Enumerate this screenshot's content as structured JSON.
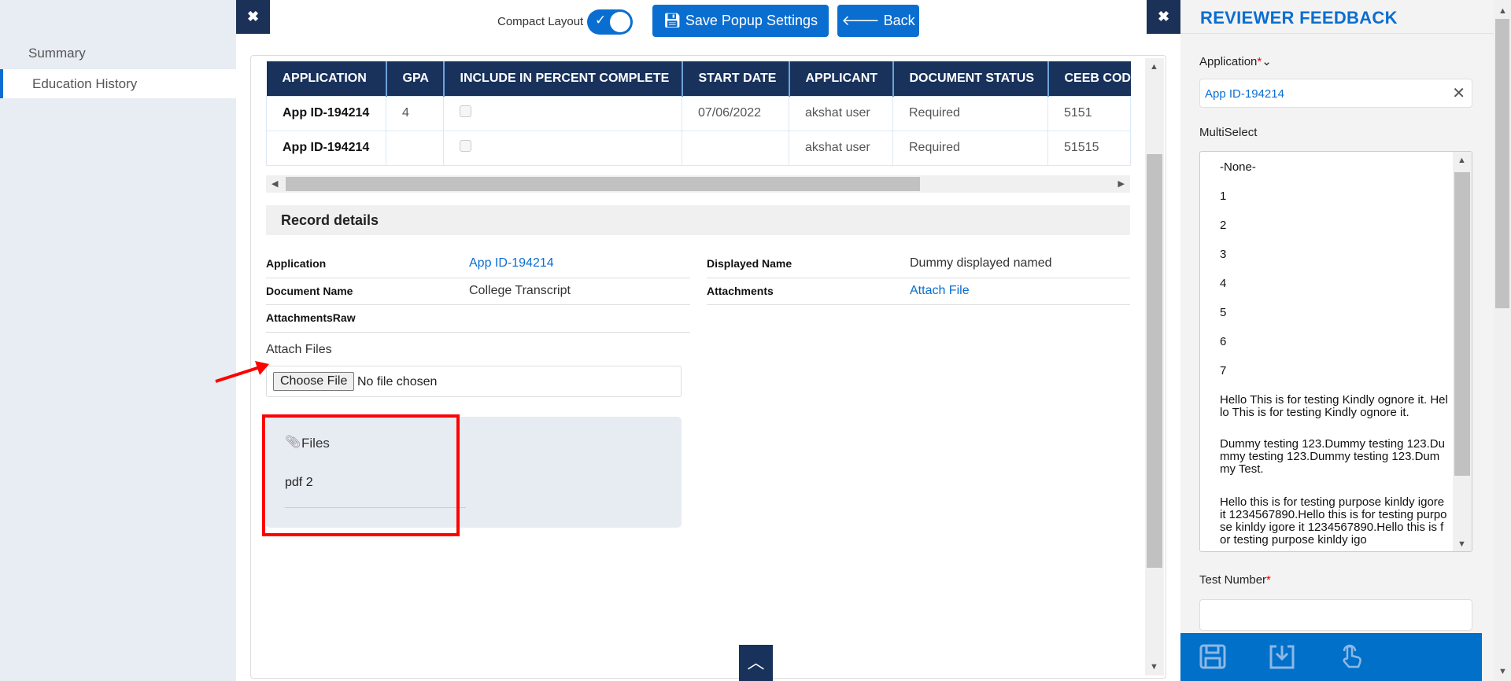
{
  "sidebar": {
    "items": [
      {
        "label": "Summary"
      },
      {
        "label": "Education History"
      }
    ]
  },
  "toolbar": {
    "close": "✖",
    "compact_label": "Compact Layout",
    "compact_on": true,
    "save_label": "Save Popup Settings",
    "back_label": "Back"
  },
  "table": {
    "headers": [
      "APPLICATION",
      "GPA",
      "INCLUDE IN PERCENT COMPLETE",
      "START DATE",
      "APPLICANT",
      "DOCUMENT STATUS",
      "CEEB CODE"
    ],
    "rows": [
      [
        "App ID-194214",
        "4",
        "",
        "07/06/2022",
        "akshat user",
        "Required",
        "5151"
      ],
      [
        "App ID-194214",
        "",
        "",
        "",
        "akshat user",
        "Required",
        "51515"
      ]
    ]
  },
  "record": {
    "title": "Record details",
    "application_label": "Application",
    "application_value": "App ID-194214",
    "document_name_label": "Document Name",
    "document_name_value": "College Transcript",
    "attachments_raw_label": "AttachmentsRaw",
    "displayed_name_label": "Displayed Name",
    "displayed_name_value": "Dummy displayed named",
    "attachments_label": "Attachments",
    "attachments_value": "Attach File",
    "attach_files_label": "Attach Files",
    "choose_file": "Choose File",
    "no_file": "No file chosen",
    "files_title": "Files",
    "files": [
      "pdf 2"
    ]
  },
  "right": {
    "close": "✖",
    "title": "REVIEWER FEEDBACK",
    "application_label": "Application",
    "required": "*",
    "application_value": "App ID-194214",
    "multiselect_label": "MultiSelect",
    "options": [
      "-None-",
      "1",
      "2",
      "3",
      "4",
      "5",
      "6",
      "7",
      "Hello This is for testing Kindly ognore it. Hello This is for testing Kindly ognore it.",
      "Dummy testing 123.Dummy testing 123.Dummy testing 123.Dummy testing 123.Dummy Test.",
      "Hello this is for testing purpose kinldy igore it 1234567890.Hello this is for testing purpose kinldy igore it 1234567890.Hello this is for testing purpose kinldy igo"
    ],
    "test_number_label": "Test Number"
  },
  "colors": {
    "accent": "#0a6ed1",
    "header": "#18325c",
    "highlight": "#ff0000"
  }
}
